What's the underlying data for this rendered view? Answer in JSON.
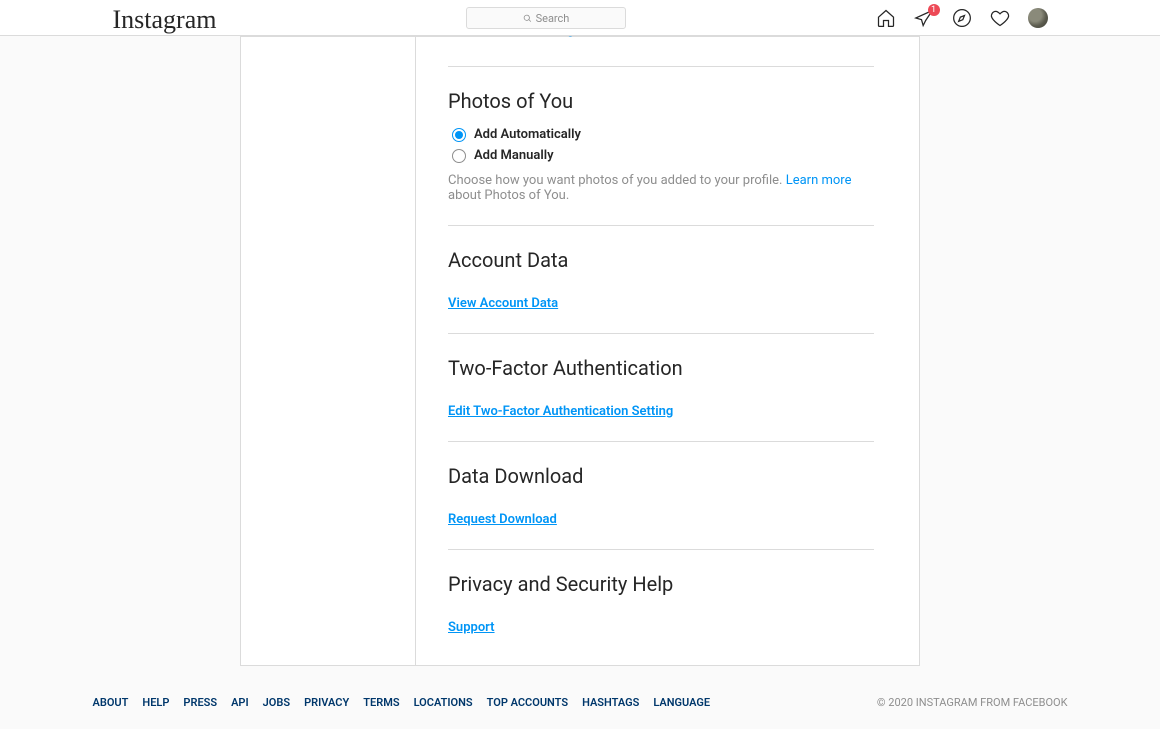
{
  "nav": {
    "brand": "Instagram",
    "search_placeholder": "Search",
    "badge_count": "1"
  },
  "settings": {
    "truncated_link": "Edit Comment Settings",
    "photos": {
      "title": "Photos of You",
      "opt_auto": "Add Automatically",
      "opt_manual": "Add Manually",
      "help_prefix": "Choose how you want photos of you added to your profile. ",
      "learn_more": "Learn more",
      "help_suffix": " about Photos of You."
    },
    "account_data": {
      "title": "Account Data",
      "link": "View Account Data"
    },
    "two_factor": {
      "title": "Two-Factor Authentication",
      "link": "Edit Two-Factor Authentication Setting"
    },
    "data_download": {
      "title": "Data Download",
      "link": "Request Download"
    },
    "privacy_help": {
      "title": "Privacy and Security Help",
      "link": "Support"
    }
  },
  "footer": {
    "links": [
      "ABOUT",
      "HELP",
      "PRESS",
      "API",
      "JOBS",
      "PRIVACY",
      "TERMS",
      "LOCATIONS",
      "TOP ACCOUNTS",
      "HASHTAGS",
      "LANGUAGE"
    ],
    "copyright": "© 2020 INSTAGRAM FROM FACEBOOK"
  }
}
